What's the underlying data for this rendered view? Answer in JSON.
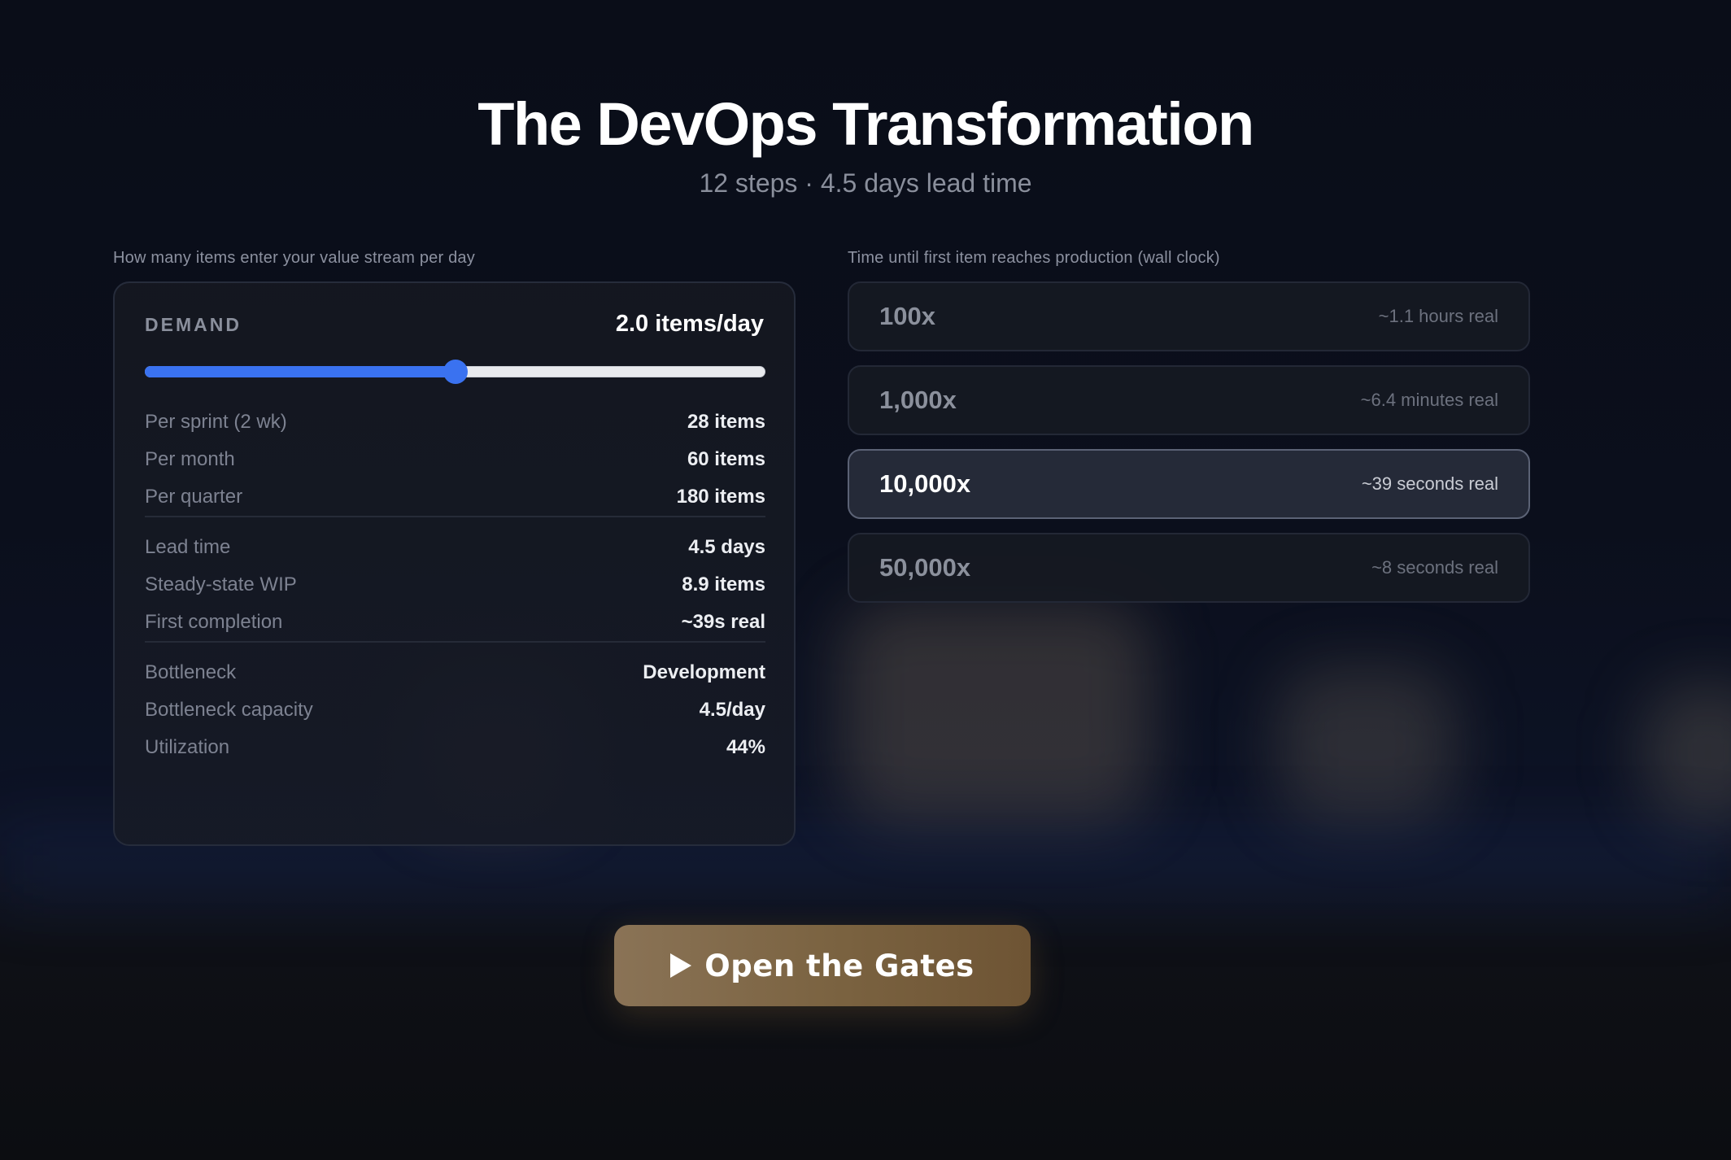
{
  "header": {
    "title": "The DevOps Transformation",
    "subtitle": "12 steps · 4.5 days lead time"
  },
  "demand_panel": {
    "caption": "How many items enter your value stream per day",
    "label": "DEMAND",
    "value": "2.0 items/day",
    "slider": {
      "fraction": 0.5,
      "accent": "#3a72f0"
    },
    "groups": [
      [
        {
          "key": "Per sprint (2 wk)",
          "value": "28 items"
        },
        {
          "key": "Per month",
          "value": "60 items"
        },
        {
          "key": "Per quarter",
          "value": "180 items"
        }
      ],
      [
        {
          "key": "Lead time",
          "value": "4.5 days"
        },
        {
          "key": "Steady-state WIP",
          "value": "8.9 items"
        },
        {
          "key": "First completion",
          "value": "~39s real"
        }
      ],
      [
        {
          "key": "Bottleneck",
          "value": "Development"
        },
        {
          "key": "Bottleneck capacity",
          "value": "4.5/day"
        },
        {
          "key": "Utilization",
          "value": "44%"
        }
      ]
    ]
  },
  "speed_panel": {
    "caption": "Time until first item reaches production (wall clock)",
    "options": [
      {
        "multiplier": "100x",
        "real": "~1.1 hours real",
        "selected": false
      },
      {
        "multiplier": "1,000x",
        "real": "~6.4 minutes real",
        "selected": false
      },
      {
        "multiplier": "10,000x",
        "real": "~39 seconds real",
        "selected": true
      },
      {
        "multiplier": "50,000x",
        "real": "~8 seconds real",
        "selected": false
      }
    ]
  },
  "action": {
    "label": "Open the Gates",
    "icon": "play-icon",
    "color": "#7a6240"
  }
}
